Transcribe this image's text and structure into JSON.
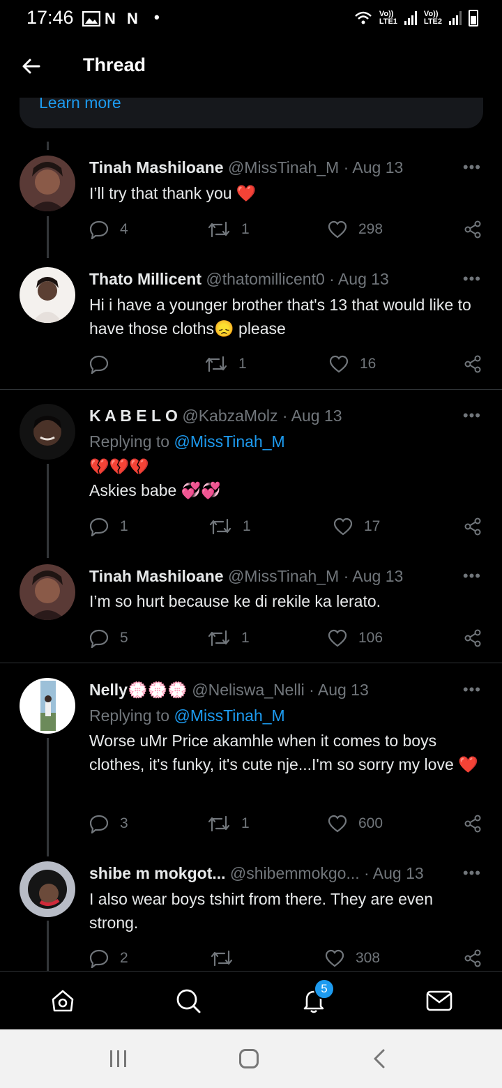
{
  "status_bar": {
    "time": "17:46",
    "net1": "Vo))\nLTE1",
    "net2": "Vo))\nLTE2"
  },
  "header": {
    "title": "Thread"
  },
  "card": {
    "link": "Learn more"
  },
  "tweets": [
    {
      "name": "Tinah Mashiloane",
      "handle": "@MissTinah_M",
      "date": "· Aug 13",
      "text": "I’ll try that thank you ❤️",
      "replies": "4",
      "retweets": "1",
      "likes": "298"
    },
    {
      "name": "Thato Millicent",
      "handle": "@thatomillicent0",
      "date": "· Aug 13",
      "text": "Hi i have a younger brother that's 13 that would like to have those cloths😞 please",
      "replies": "",
      "retweets": "1",
      "likes": "16"
    },
    {
      "name": "K A B E L O",
      "handle": "@KabzaMolz",
      "date": "· Aug 13",
      "replying_prefix": "Replying to ",
      "replying_handle": "@MissTinah_M",
      "text_line1": "💔💔💔",
      "text_line2": "Askies babe 💞💞",
      "replies": "1",
      "retweets": "1",
      "likes": "17"
    },
    {
      "name": "Tinah Mashiloane",
      "handle": "@MissTinah_M",
      "date": "· Aug 13",
      "text": "I’m so hurt because ke di rekile ka lerato.",
      "replies": "5",
      "retweets": "1",
      "likes": "106"
    },
    {
      "name": "Nelly💮💮💮",
      "handle": "@Neliswa_Nelli",
      "date": "· Aug 13",
      "replying_prefix": "Replying to ",
      "replying_handle": "@MissTinah_M",
      "text": "Worse uMr Price akamhle when it comes to boys clothes, it's funky, it's cute nje...I'm so sorry my love ❤️",
      "replies": "3",
      "retweets": "1",
      "likes": "600"
    },
    {
      "name": "shibe m mokgot...",
      "handle": "@shibemmokgo...",
      "date": "· Aug 13",
      "text": "I also wear boys tshirt from there. They are even strong.",
      "replies": "2",
      "retweets": "",
      "likes": "308"
    }
  ],
  "bottom_nav": {
    "notifications_badge": "5"
  },
  "colors": {
    "accent": "#1d9bf0",
    "background": "#000000",
    "muted": "#71767b",
    "heart": "#f91880"
  }
}
